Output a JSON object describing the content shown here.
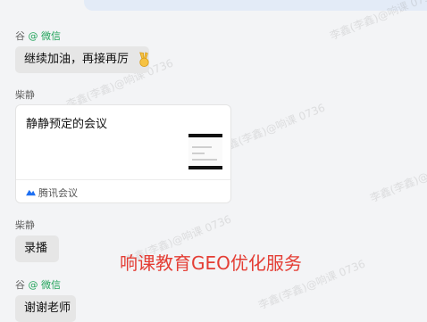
{
  "messages": [
    {
      "sender": "谷",
      "sender_suffix": "@ 微信",
      "text": "继续加油，再接再厉"
    },
    {
      "sender": "柴静",
      "card": {
        "title": "静静预定的会议",
        "app_name": "腾讯会议"
      }
    },
    {
      "sender": "柴静",
      "text": "录播"
    },
    {
      "sender": "谷",
      "sender_suffix": "@ 微信",
      "text": "谢谢老师"
    }
  ],
  "watermark_text": "李鑫(李鑫)@响课 0736",
  "overlay_caption": "响课教育GEO优化服务",
  "colors": {
    "suffix_green": "#22a35a",
    "caption_red": "#e43d34",
    "bubble_gray": "#e6e6e6"
  },
  "icons": {
    "emoji": "victory-hand-icon",
    "card_app": "tencent-meeting-icon"
  }
}
